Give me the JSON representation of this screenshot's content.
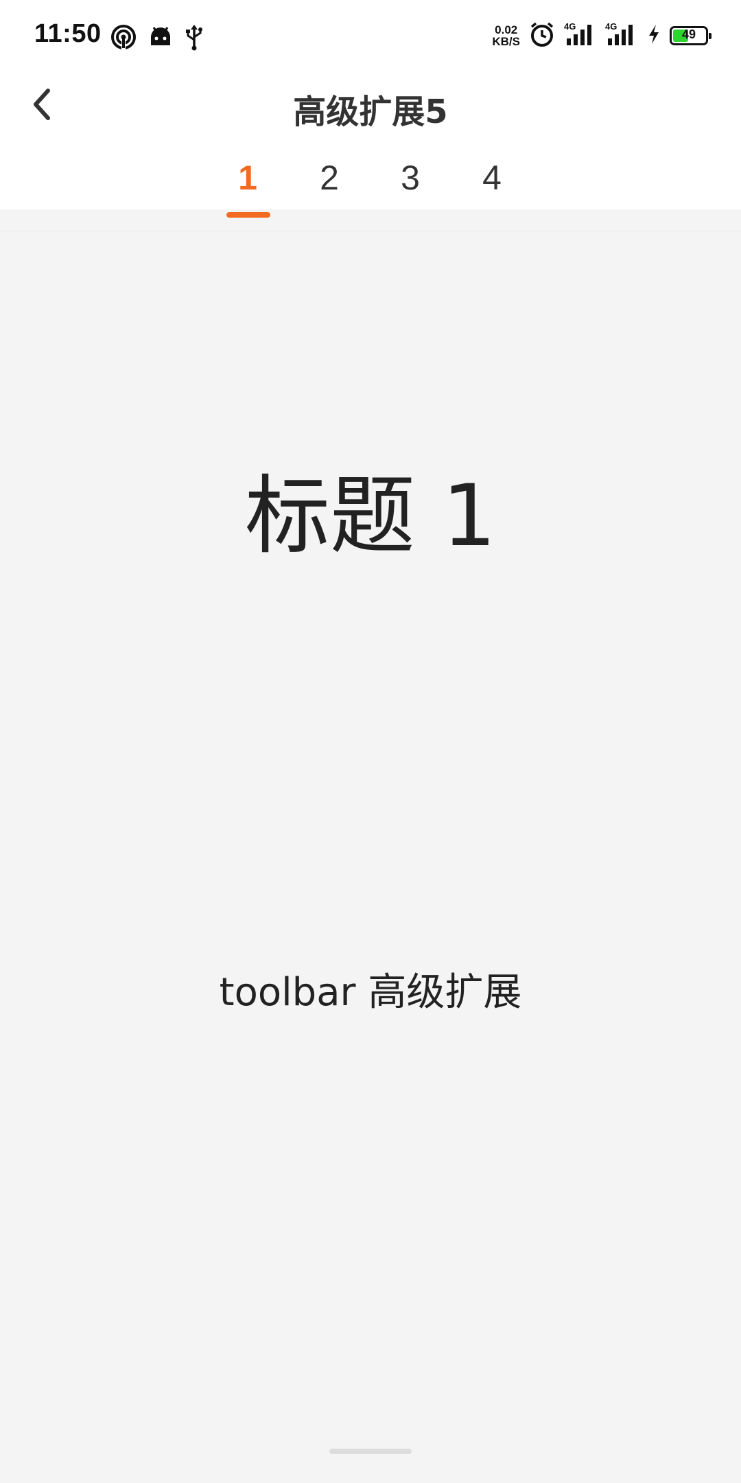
{
  "status_bar": {
    "time": "11:50",
    "left_icons": [
      "hotspot-icon",
      "android-icon",
      "usb-icon"
    ],
    "net_speed_value": "0.02",
    "net_speed_unit": "KB/S",
    "right_icons": [
      "alarm-icon",
      "signal-4g-icon",
      "signal-4g-icon",
      "charging-icon"
    ],
    "battery_level": "49",
    "battery_color": "#2ed52e"
  },
  "toolbar": {
    "back_icon": "chevron-left-icon",
    "title": "高级扩展5",
    "tabs": [
      {
        "label": "1",
        "active": true
      },
      {
        "label": "2",
        "active": false
      },
      {
        "label": "3",
        "active": false
      },
      {
        "label": "4",
        "active": false
      }
    ],
    "accent_color": "#f36b21"
  },
  "content": {
    "heading": "标题 1",
    "subtitle": "toolbar 高级扩展"
  }
}
